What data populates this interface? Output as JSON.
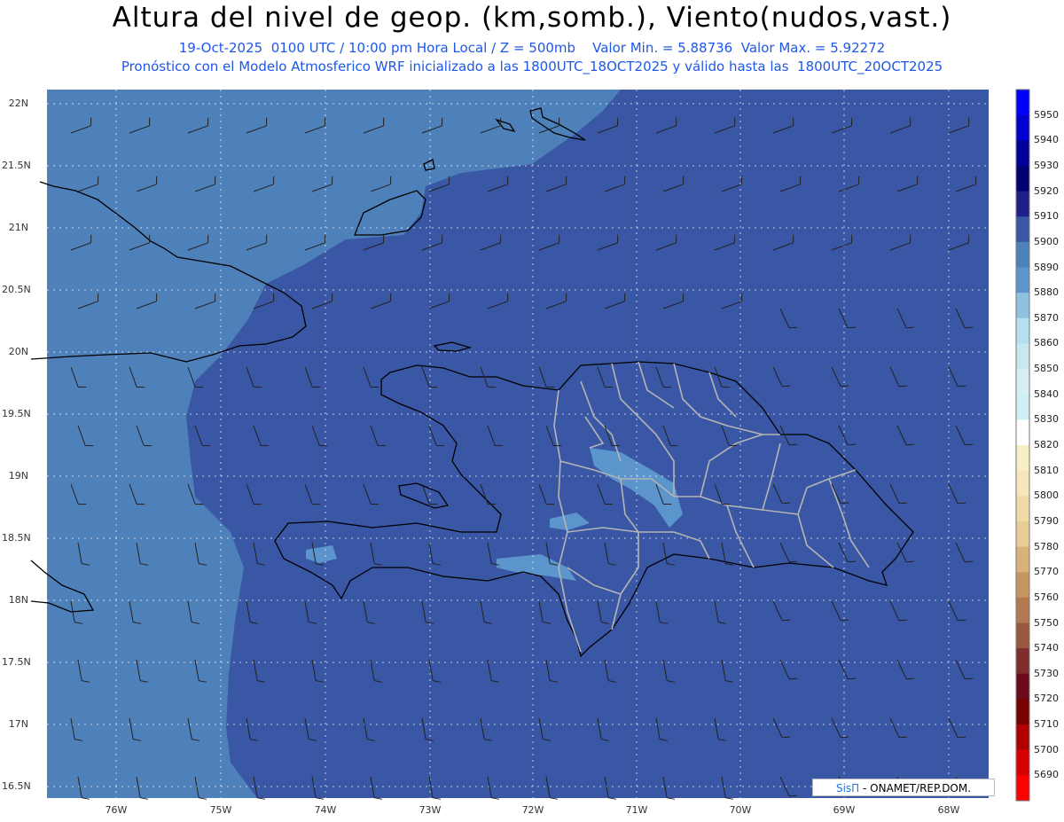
{
  "header": {
    "title": "Altura del nivel de geop. (km,somb.), Viento(nudos,vast.)",
    "subtitle_1": "19-Oct-2025  0100 UTC / 10:00 pm Hora Local / Z = 500mb    Valor Min. = 5.88736  Valor Max. = 5.92272",
    "subtitle_2": "Pronóstico con el Modelo Atmosferico WRF inicializado a las 1800UTC_18OCT2025 y válido hasta las  1800UTC_20OCT2025"
  },
  "map": {
    "lat_labels": [
      "22N",
      "21.5N",
      "21N",
      "20.5N",
      "20N",
      "19.5N",
      "19N",
      "18.5N",
      "18N",
      "17.5N",
      "17N",
      "16.5N"
    ],
    "lon_labels": [
      "76W",
      "75W",
      "74W",
      "73W",
      "72W",
      "71W",
      "70W",
      "69W",
      "68W"
    ],
    "colors": {
      "level_5890": "#4e80ba",
      "level_5900": "#3a57a5",
      "level_5880": "#5b95cc",
      "coast": "#000000",
      "provinces": "#b4b4b4",
      "gridlines": "#ffffff",
      "barbs": "#222222"
    }
  },
  "colorbar": {
    "labels": [
      "5950",
      "5940",
      "5930",
      "5920",
      "5910",
      "5900",
      "5890",
      "5880",
      "5870",
      "5860",
      "5850",
      "5840",
      "5830",
      "5820",
      "5810",
      "5800",
      "5790",
      "5780",
      "5770",
      "5760",
      "5750",
      "5740",
      "5730",
      "5720",
      "5710",
      "5700",
      "5690"
    ],
    "colors": [
      "#0000ff",
      "#0000d2",
      "#00009b",
      "#00006e",
      "#1f1f8a",
      "#3a57a5",
      "#4e80ba",
      "#5b95cc",
      "#8fc1e0",
      "#b5dfec",
      "#c8e8f0",
      "#d8eef5",
      "#cdeff5",
      "#ffffff",
      "#f9efc7",
      "#f5e6bb",
      "#efdca8",
      "#e8cd96",
      "#d9b27a",
      "#c59562",
      "#b27a52",
      "#9a5840",
      "#7e2c2c",
      "#6b0a1a",
      "#7a0000",
      "#b00000",
      "#d90000",
      "#ff0000"
    ]
  },
  "credit": {
    "brand": "SisΠ",
    "text": " - ONAMET/REP.DOM."
  }
}
